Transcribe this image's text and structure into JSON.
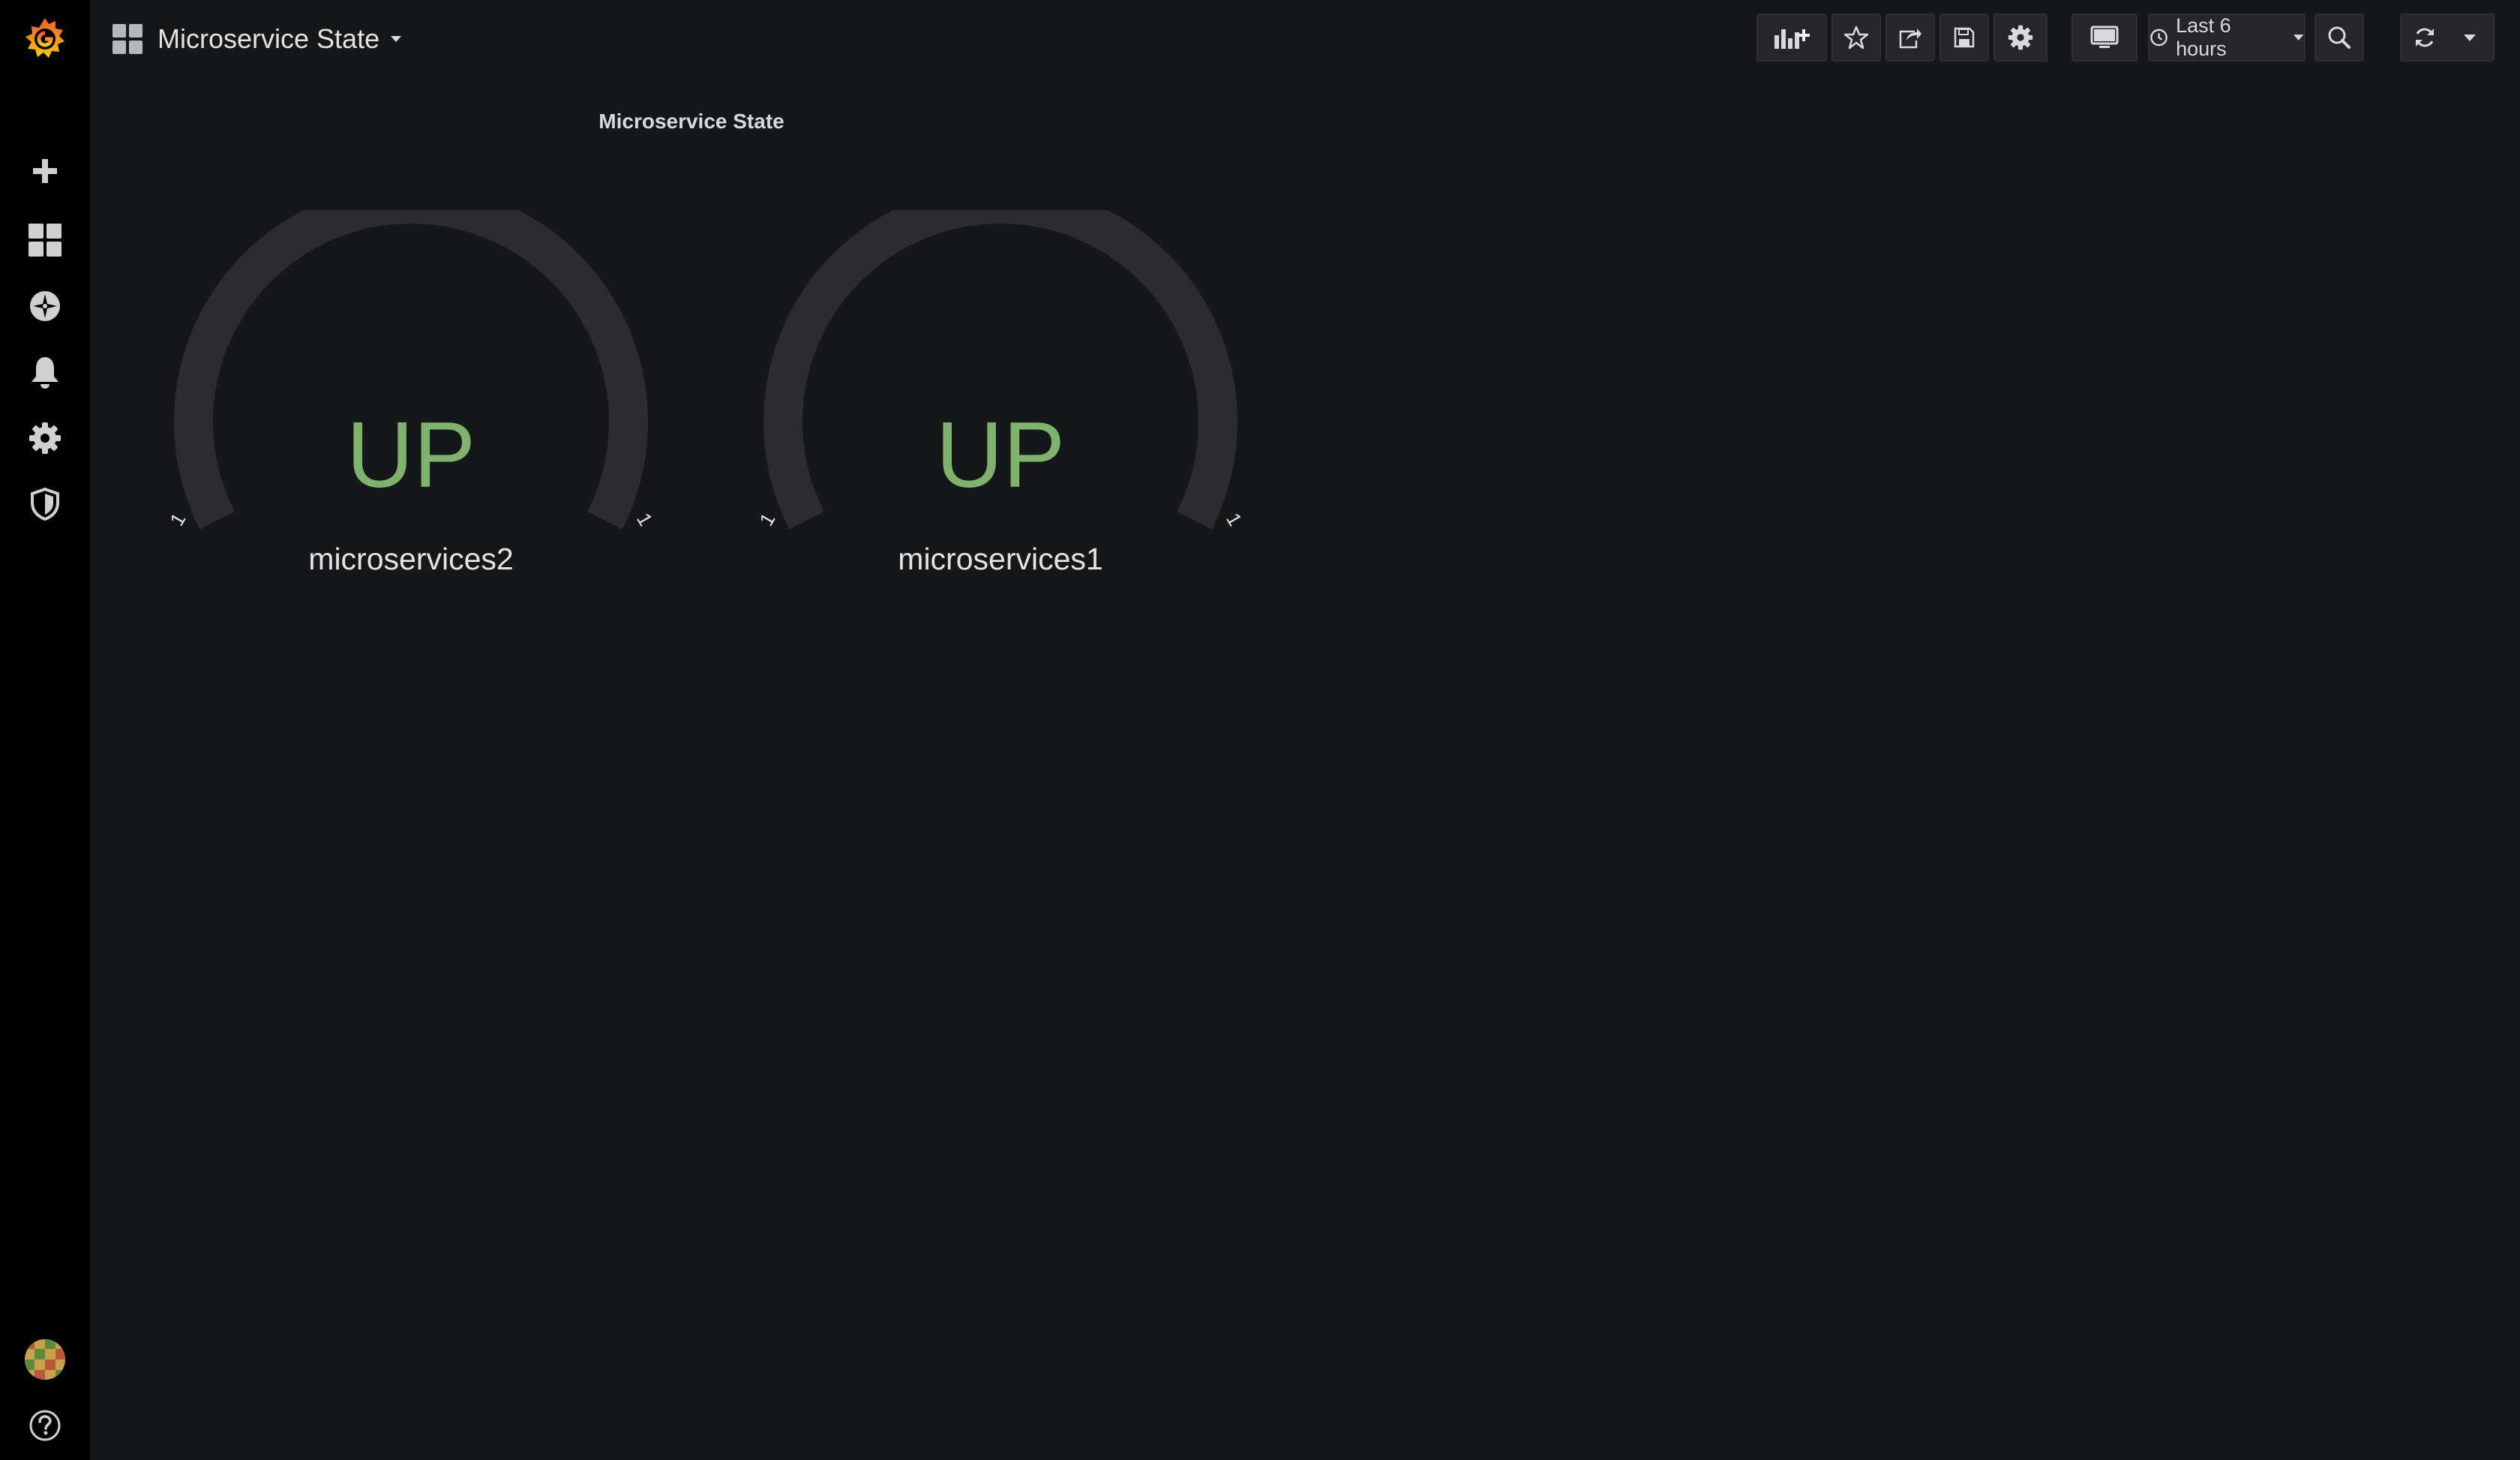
{
  "dashboard": {
    "title": "Microservice State"
  },
  "toolbar": {
    "time_range_label": "Last 6 hours"
  },
  "panel": {
    "title": "Microservice State",
    "gauges": [
      {
        "value": "UP",
        "name": "microservices2",
        "min_label": "1",
        "max_label": "1",
        "value_color": "#7eb26d"
      },
      {
        "value": "UP",
        "name": "microservices1",
        "min_label": "1",
        "max_label": "1",
        "value_color": "#7eb26d"
      }
    ]
  },
  "colors": {
    "background": "#161719",
    "sidebar": "#000000",
    "accent_orange": "#f46800",
    "gauge_track": "#2c2c2f",
    "ok_green": "#7eb26d"
  },
  "icons": {
    "sidebar": [
      "grafana-logo-icon",
      "plus-icon",
      "dashboards-grid-icon",
      "explore-compass-icon",
      "bell-icon",
      "gear-icon",
      "shield-icon",
      "avatar",
      "help-icon"
    ],
    "toolbar": [
      "add-panel-icon",
      "star-icon",
      "share-icon",
      "save-icon",
      "gear-icon",
      "tv-monitor-icon",
      "clock-icon",
      "zoom-out-icon",
      "refresh-icon",
      "chevron-down-icon"
    ]
  }
}
